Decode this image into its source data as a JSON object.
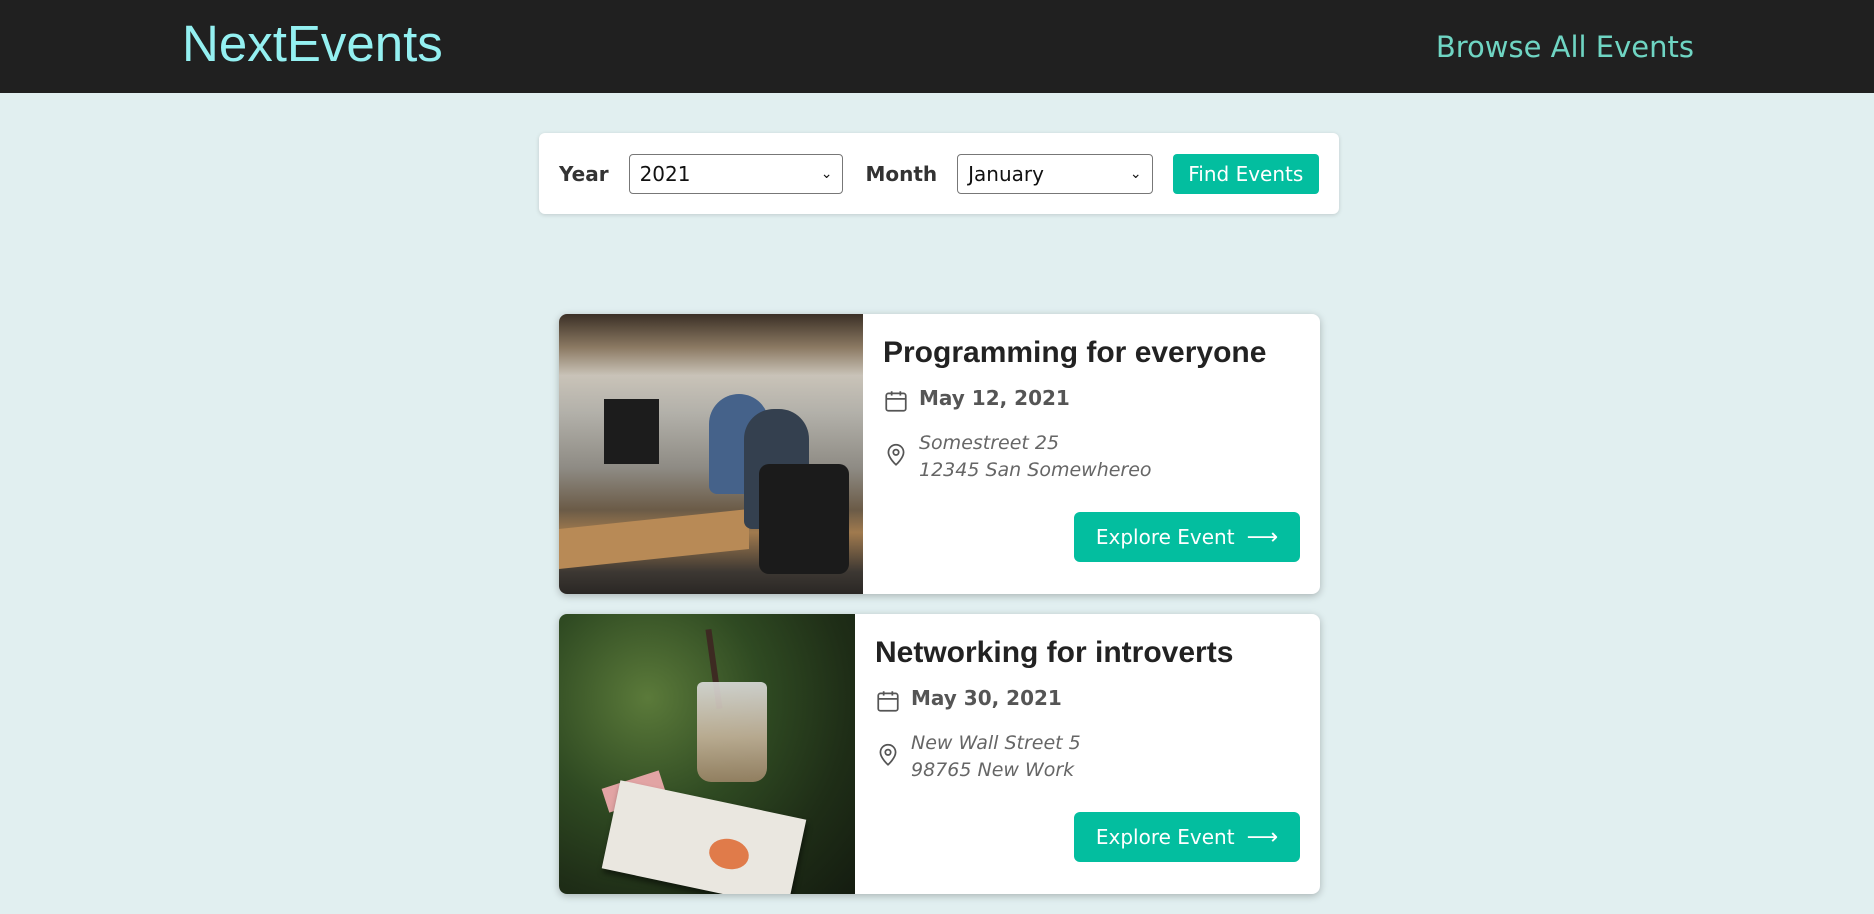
{
  "header": {
    "logo": "NextEvents",
    "nav_link": "Browse All Events"
  },
  "search": {
    "year_label": "Year",
    "year_value": "2021",
    "month_label": "Month",
    "month_value": "January",
    "submit_label": "Find Events"
  },
  "events": [
    {
      "title": "Programming for everyone",
      "date": "May 12, 2021",
      "address": "Somestreet 25\n 12345 San Somewhereo",
      "button_label": "Explore Event",
      "image_icon": "office-photo"
    },
    {
      "title": "Networking for introverts",
      "date": "May 30, 2021",
      "address": "New Wall Street 5\n 98765 New Work",
      "button_label": "Explore Event",
      "image_icon": "coffee-book-photo"
    }
  ],
  "colors": {
    "header_bg": "#202020",
    "logo": "#94f0f1",
    "nav_link": "#6fd5c3",
    "page_bg": "#e1eff0",
    "accent": "#03be9f"
  }
}
